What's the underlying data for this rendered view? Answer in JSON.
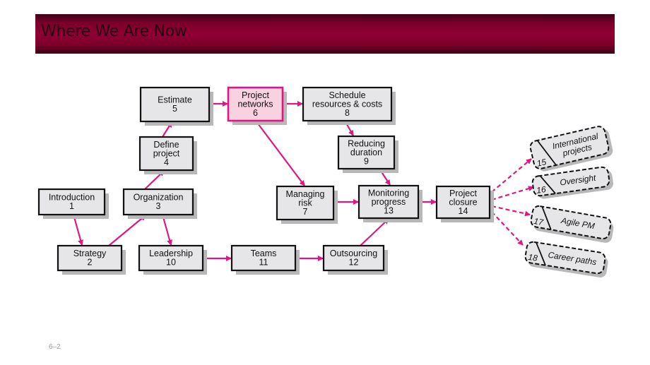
{
  "header": {
    "title": "Where We Are Now"
  },
  "footer": {
    "slide_number": "6–2"
  },
  "colors": {
    "header_dark": "#3f0018",
    "header_mid": "#8f0033",
    "arrow": "#e0177f",
    "box_fill": "#e6e6e8",
    "highlight_fill": "#f9d2e2",
    "highlight_border": "#e0177f",
    "shadow": "#b8b8b8"
  },
  "nodes": [
    {
      "id": 1,
      "lines": [
        "Introduction",
        "1"
      ]
    },
    {
      "id": 2,
      "lines": [
        "Strategy",
        "2"
      ]
    },
    {
      "id": 3,
      "lines": [
        "Organization",
        "3"
      ]
    },
    {
      "id": 4,
      "lines": [
        "Define",
        "project",
        "4"
      ]
    },
    {
      "id": 5,
      "lines": [
        "Estimate",
        "5"
      ]
    },
    {
      "id": 6,
      "lines": [
        "Project",
        "networks",
        "6"
      ],
      "highlighted": true
    },
    {
      "id": 7,
      "lines": [
        "Managing",
        "risk",
        "7"
      ]
    },
    {
      "id": 8,
      "lines": [
        "Schedule",
        "resources & costs",
        "8"
      ]
    },
    {
      "id": 9,
      "lines": [
        "Reducing",
        "duration",
        "9"
      ]
    },
    {
      "id": 10,
      "lines": [
        "Leadership",
        "10"
      ]
    },
    {
      "id": 11,
      "lines": [
        "Teams",
        "11"
      ]
    },
    {
      "id": 12,
      "lines": [
        "Outsourcing",
        "12"
      ]
    },
    {
      "id": 13,
      "lines": [
        "Monitoring",
        "progress",
        "13"
      ]
    },
    {
      "id": 14,
      "lines": [
        "Project",
        "closure",
        "14"
      ]
    }
  ],
  "optional_nodes": [
    {
      "id": 15,
      "number": "15",
      "lines": [
        "International",
        "projects"
      ]
    },
    {
      "id": 16,
      "number": "16",
      "lines": [
        "Oversight"
      ]
    },
    {
      "id": 17,
      "number": "17",
      "lines": [
        "Agile PM"
      ]
    },
    {
      "id": 18,
      "number": "18",
      "lines": [
        "Career paths"
      ]
    }
  ],
  "edges": [
    {
      "from": 1,
      "to": 2
    },
    {
      "from": 2,
      "to": 3
    },
    {
      "from": 3,
      "to": 4
    },
    {
      "from": 3,
      "to": 10
    },
    {
      "from": 4,
      "to": 5
    },
    {
      "from": 5,
      "to": 6
    },
    {
      "from": 6,
      "to": 8
    },
    {
      "from": 6,
      "to": 7
    },
    {
      "from": 8,
      "to": 9
    },
    {
      "from": 9,
      "to": 13
    },
    {
      "from": 7,
      "to": 13
    },
    {
      "from": 10,
      "to": 11
    },
    {
      "from": 11,
      "to": 12
    },
    {
      "from": 12,
      "to": 13
    },
    {
      "from": 13,
      "to": 14
    },
    {
      "from": 14,
      "to": 15,
      "dashed": true
    },
    {
      "from": 14,
      "to": 16,
      "dashed": true
    },
    {
      "from": 14,
      "to": 17,
      "dashed": true
    },
    {
      "from": 14,
      "to": 18,
      "dashed": true
    }
  ]
}
